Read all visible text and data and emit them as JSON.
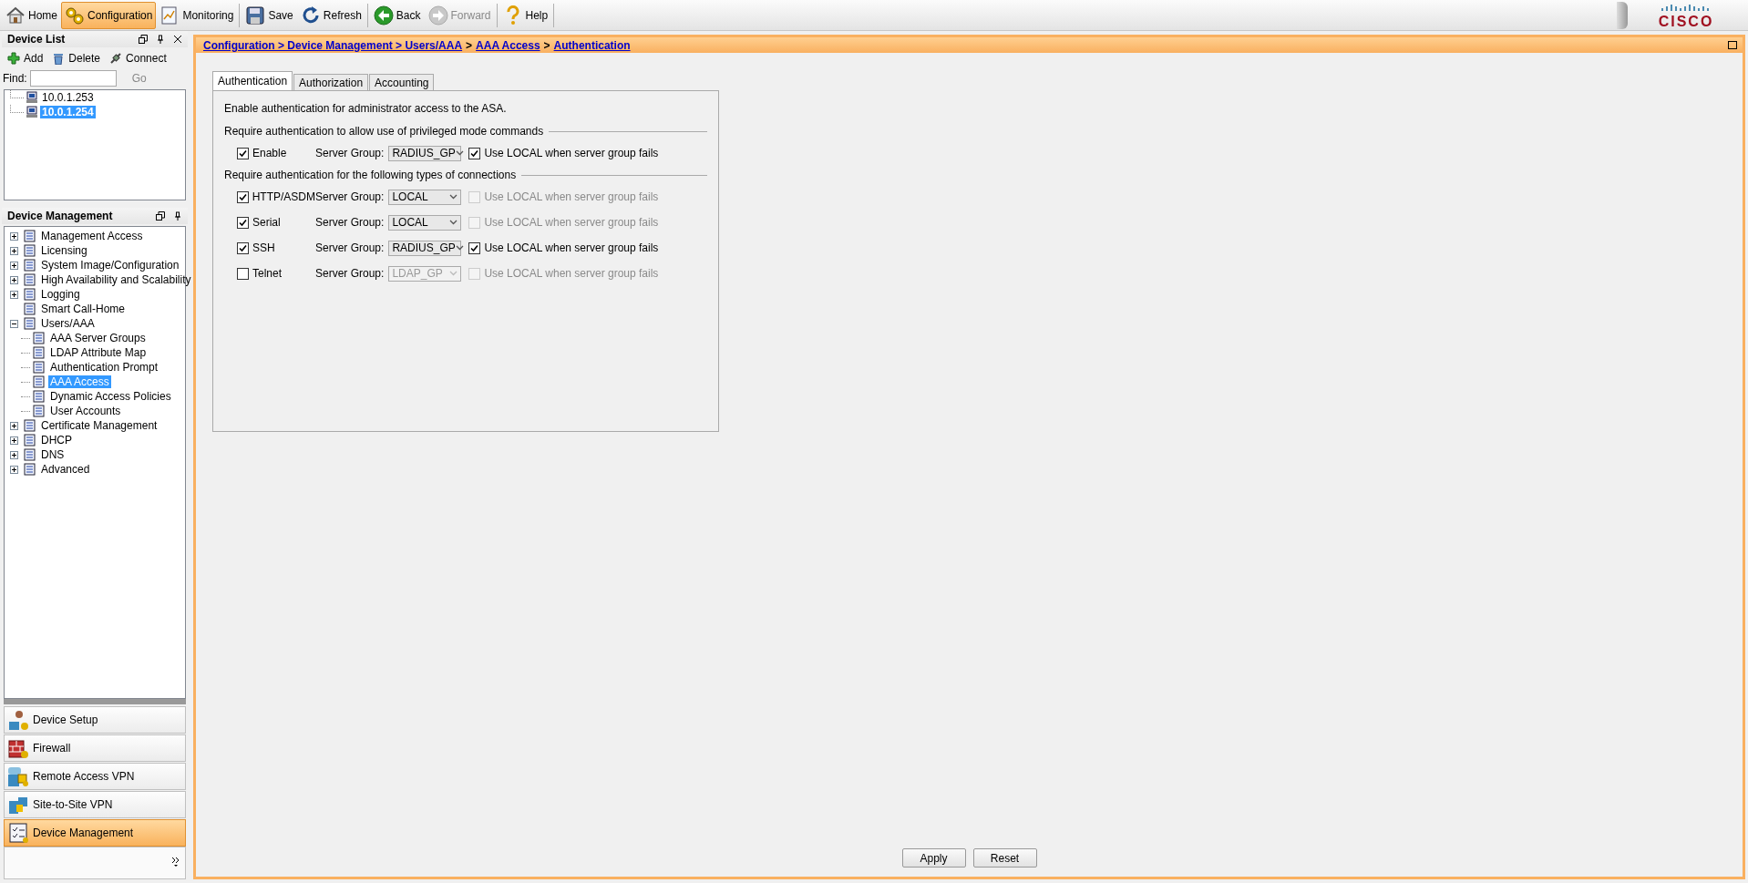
{
  "toolbar": {
    "buttons": [
      {
        "label": "Home",
        "selected": false,
        "disabled": false
      },
      {
        "label": "Configuration",
        "selected": true,
        "disabled": false
      },
      {
        "label": "Monitoring",
        "selected": false,
        "disabled": false
      },
      {
        "label": "Save",
        "selected": false,
        "disabled": false
      },
      {
        "label": "Refresh",
        "selected": false,
        "disabled": false
      },
      {
        "label": "Back",
        "selected": false,
        "disabled": false
      },
      {
        "label": "Forward",
        "selected": false,
        "disabled": true
      },
      {
        "label": "Help",
        "selected": false,
        "disabled": false
      }
    ],
    "logo": "CISCO"
  },
  "device_list": {
    "title": "Device List",
    "actions": [
      "Add",
      "Delete",
      "Connect"
    ],
    "find_label": "Find:",
    "go_label": "Go",
    "devices": [
      {
        "label": "10.0.1.253",
        "selected": false
      },
      {
        "label": "10.0.1.254",
        "selected": true
      }
    ]
  },
  "device_management": {
    "title": "Device Management",
    "tree": [
      {
        "label": "Management Access",
        "selected": false,
        "expanded": false,
        "kind": "folder"
      },
      {
        "label": "Licensing",
        "selected": false,
        "expanded": false,
        "kind": "folder"
      },
      {
        "label": "System Image/Configuration",
        "selected": false,
        "expanded": false,
        "kind": "folder"
      },
      {
        "label": "High Availability and Scalability",
        "selected": false,
        "expanded": false,
        "kind": "folder"
      },
      {
        "label": "Logging",
        "selected": false,
        "expanded": false,
        "kind": "folder"
      },
      {
        "label": "Smart Call-Home",
        "selected": false,
        "kind": "leaf"
      },
      {
        "label": "Users/AAA",
        "selected": false,
        "expanded": true,
        "kind": "folder",
        "children": [
          {
            "label": "AAA Server Groups",
            "selected": false,
            "kind": "leaf"
          },
          {
            "label": "LDAP Attribute Map",
            "selected": false,
            "kind": "leaf"
          },
          {
            "label": "Authentication Prompt",
            "selected": false,
            "kind": "leaf"
          },
          {
            "label": "AAA Access",
            "selected": true,
            "kind": "leaf"
          },
          {
            "label": "Dynamic Access Policies",
            "selected": false,
            "kind": "leaf"
          },
          {
            "label": "User Accounts",
            "selected": false,
            "kind": "leaf"
          }
        ]
      },
      {
        "label": "Certificate Management",
        "selected": false,
        "expanded": false,
        "kind": "folder"
      },
      {
        "label": "DHCP",
        "selected": false,
        "expanded": false,
        "kind": "folder"
      },
      {
        "label": "DNS",
        "selected": false,
        "expanded": false,
        "kind": "folder"
      },
      {
        "label": "Advanced",
        "selected": false,
        "expanded": false,
        "kind": "folder"
      }
    ]
  },
  "navigation": [
    {
      "label": "Device Setup",
      "selected": false
    },
    {
      "label": "Firewall",
      "selected": false
    },
    {
      "label": "Remote Access VPN",
      "selected": false
    },
    {
      "label": "Site-to-Site VPN",
      "selected": false
    },
    {
      "label": "Device Management",
      "selected": true
    }
  ],
  "breadcrumb": [
    {
      "kind": "link",
      "text": "Configuration > Device Management > Users/AAA"
    },
    {
      "kind": "separator",
      "text": ">"
    },
    {
      "kind": "link",
      "text": "AAA Access"
    },
    {
      "kind": "separator",
      "text": ">"
    },
    {
      "kind": "link",
      "text": "Authentication"
    }
  ],
  "tabs": [
    {
      "label": "Authentication",
      "selected": true
    },
    {
      "label": "Authorization",
      "selected": false
    },
    {
      "label": "Accounting",
      "selected": false
    }
  ],
  "intro": "Enable authentication for administrator access to the ASA.",
  "sections": [
    {
      "title": "Require authentication to allow use of privileged mode commands",
      "rows": [
        {
          "label": "Enable",
          "checked": true,
          "group_label": "Server Group:",
          "server_group": "RADIUS_GP",
          "group_disabled": false,
          "fallback_label": "Use LOCAL when server group fails",
          "fallback_checked": true,
          "fallback_disabled": false
        }
      ]
    },
    {
      "title": "Require authentication for the following types of connections",
      "rows": [
        {
          "label": "HTTP/ASDM",
          "checked": true,
          "group_label": "Server Group:",
          "server_group": "LOCAL",
          "group_disabled": false,
          "fallback_label": "Use LOCAL when server group fails",
          "fallback_checked": false,
          "fallback_disabled": true
        },
        {
          "label": "Serial",
          "checked": true,
          "group_label": "Server Group:",
          "server_group": "LOCAL",
          "group_disabled": false,
          "fallback_label": "Use LOCAL when server group fails",
          "fallback_checked": false,
          "fallback_disabled": true
        },
        {
          "label": "SSH",
          "checked": true,
          "group_label": "Server Group:",
          "server_group": "RADIUS_GP",
          "group_disabled": false,
          "fallback_label": "Use LOCAL when server group fails",
          "fallback_checked": true,
          "fallback_disabled": false
        },
        {
          "label": "Telnet",
          "checked": false,
          "group_label": "Server Group:",
          "server_group": "LDAP_GP",
          "group_disabled": true,
          "fallback_label": "Use LOCAL when server group fails",
          "fallback_checked": false,
          "fallback_disabled": true
        }
      ]
    }
  ],
  "buttons": [
    "Apply",
    "Reset"
  ]
}
